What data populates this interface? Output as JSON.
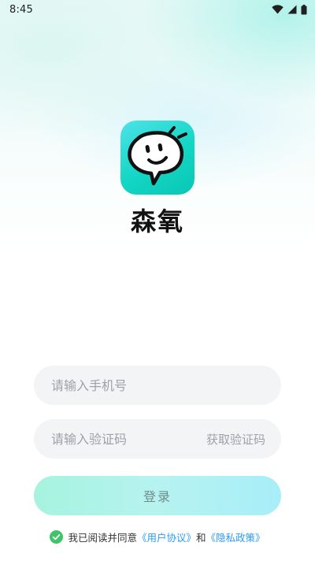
{
  "status_bar": {
    "time": "8:45",
    "icons": [
      "wifi-icon",
      "signal-icon",
      "battery-icon"
    ]
  },
  "app": {
    "name": "森氧",
    "logo_colors": {
      "start": "#4fe3e8",
      "end": "#0ac6b5"
    }
  },
  "form": {
    "phone_placeholder": "请输入手机号",
    "phone_value": "",
    "code_placeholder": "请输入验证码",
    "code_value": "",
    "get_code_label": "获取验证码",
    "login_label": "登录"
  },
  "agreement": {
    "checked": true,
    "prefix": "我已阅读并同意",
    "user_agreement": "《用户协议》",
    "conjunction": "和",
    "privacy_policy": "《隐私政策》",
    "link_color": "#2a9df4",
    "check_color": "#3fc46a"
  }
}
